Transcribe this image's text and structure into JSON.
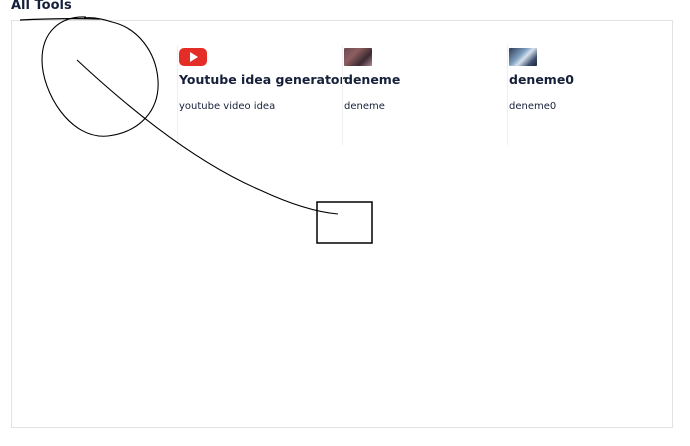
{
  "section": {
    "title": "All Tools"
  },
  "tools": [
    {
      "name": "Youtube idea generator",
      "description": "youtube video idea",
      "icon": "youtube-play-icon",
      "thumb_color": "#e52d27"
    },
    {
      "name": "deneme",
      "description": "deneme",
      "icon": "tool-image-thumbnail"
    },
    {
      "name": "deneme0",
      "description": "deneme0",
      "icon": "tool-image-thumbnail"
    }
  ],
  "annotation": {
    "stroke_color": "#000000"
  }
}
